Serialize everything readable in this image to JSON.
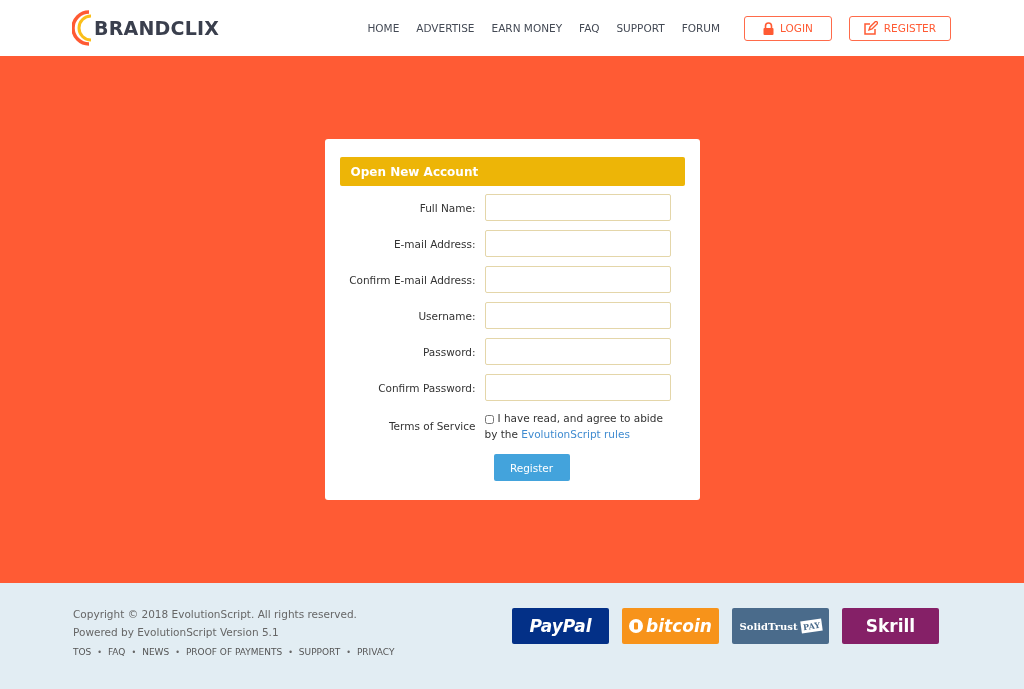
{
  "header": {
    "logo": "BRANDCLIX",
    "nav": [
      {
        "label": "HOME"
      },
      {
        "label": "ADVERTISE"
      },
      {
        "label": "EARN MONEY"
      },
      {
        "label": "FAQ"
      },
      {
        "label": "SUPPORT"
      },
      {
        "label": "FORUM"
      }
    ],
    "buttons": [
      {
        "kind": "login",
        "label": "LOGIN"
      },
      {
        "kind": "register",
        "label": "REGISTER"
      }
    ]
  },
  "form": {
    "title": "Open New Account",
    "fields": [
      {
        "label": "Full Name:"
      },
      {
        "label": "E-mail Address:"
      },
      {
        "label": "Confirm E-mail Address:"
      },
      {
        "label": "Username:"
      },
      {
        "label": "Password:"
      },
      {
        "label": "Confirm Password:"
      }
    ],
    "terms": {
      "label": "Terms of Service",
      "checked": false,
      "text": "I have read, and agree to abide by the",
      "link": "EvolutionScript rules"
    },
    "submit": "Register"
  },
  "footer": {
    "copyright": "Copyright © 2018 EvolutionScript. All rights reserved.",
    "powered": "Powered by EvolutionScript Version 5.1",
    "separator": "•",
    "links": [
      "TOS",
      "FAQ",
      "NEWS",
      "PROOF OF PAYMENTS",
      "SUPPORT",
      "PRIVACY"
    ],
    "payments": [
      {
        "kind": "paypal",
        "text": "PayPal"
      },
      {
        "kind": "bitcoin",
        "text": "bitcoin"
      },
      {
        "kind": "solidtrust",
        "text": "SolidTrust",
        "tag": "PAY"
      },
      {
        "kind": "skrill",
        "text": "Skrill"
      }
    ]
  }
}
